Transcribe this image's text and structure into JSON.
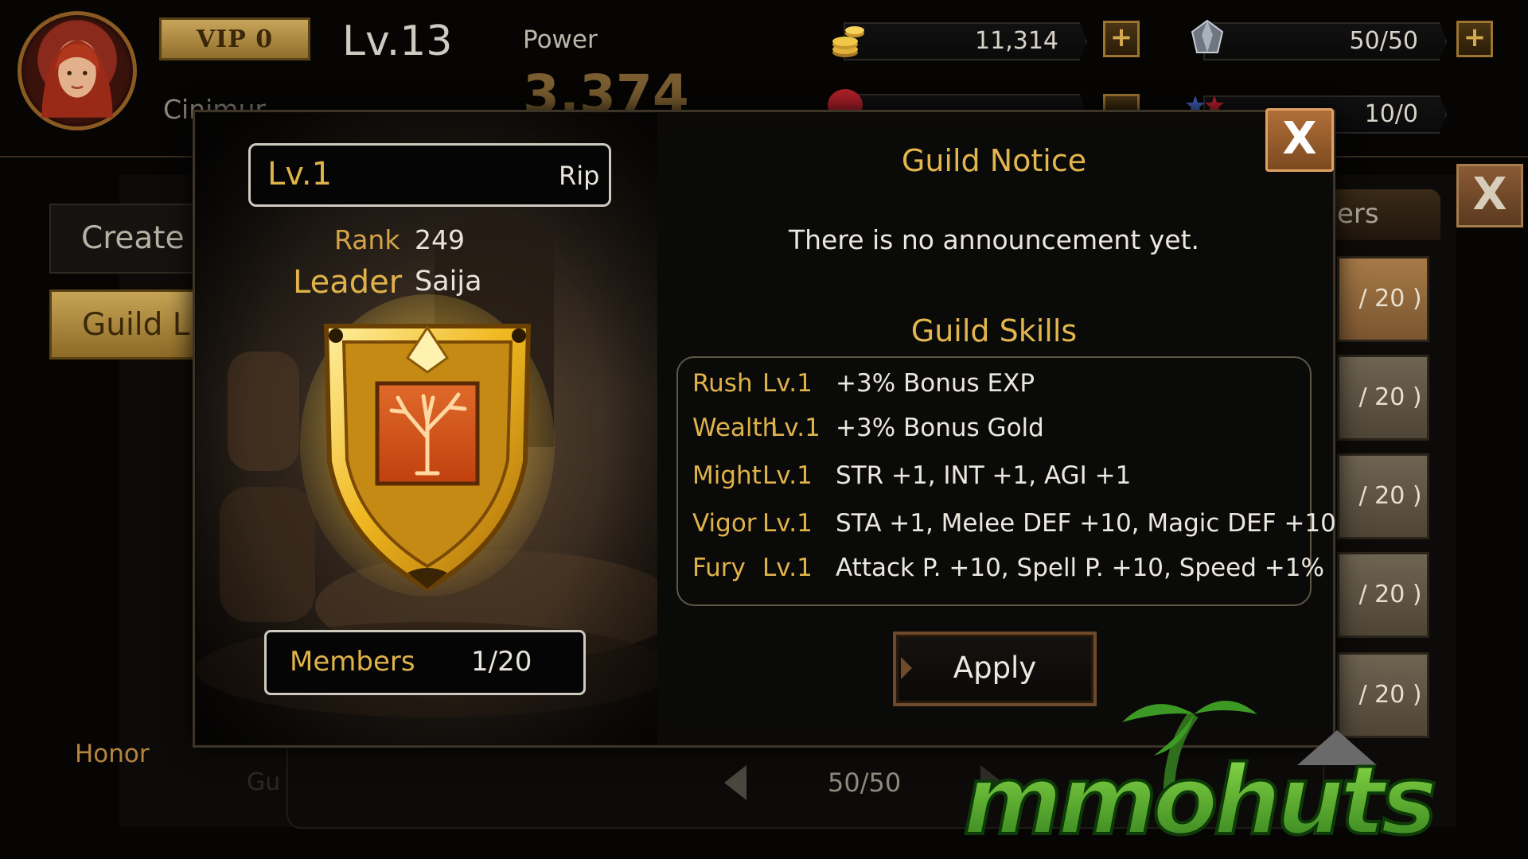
{
  "hud": {
    "vip": "VIP 0",
    "level": "Lv.13",
    "power_label": "Power",
    "power_value": "3,374",
    "player_name": "Cinimur",
    "gold": "11,314",
    "stamina": "50/50",
    "tickets": "10/0",
    "plus": "+"
  },
  "background": {
    "create_tab": "Create Guild",
    "list_tab": "Guild List",
    "honor": "Honor",
    "gu": "Gu",
    "pager": "50/50",
    "members_header": "ers",
    "slots": [
      "/ 20 )",
      "/ 20 )",
      "/ 20 )",
      "/ 20 )",
      "/ 20 )"
    ],
    "close": "X"
  },
  "dialog": {
    "level": "Lv.1",
    "guild_name": "Rip",
    "rank_label": "Rank",
    "rank_value": "249",
    "leader_label": "Leader",
    "leader_value": "Saija",
    "members_label": "Members",
    "members_value": "1/20",
    "notice_title": "Guild Notice",
    "notice_text": "There is no announcement yet.",
    "skills_title": "Guild Skills",
    "skills": [
      {
        "name": "Rush",
        "level": "Lv.1",
        "desc": "+3% Bonus EXP"
      },
      {
        "name": "Wealth",
        "level": "Lv.1",
        "desc": "+3% Bonus Gold"
      },
      {
        "name": "Might",
        "level": "Lv.1",
        "desc": "STR +1, INT +1, AGI +1"
      },
      {
        "name": "Vigor",
        "level": "Lv.1",
        "desc": "STA +1, Melee DEF +10, Magic DEF +10"
      },
      {
        "name": "Fury",
        "level": "Lv.1",
        "desc": "Attack P. +10, Spell P. +10, Speed +1%"
      }
    ],
    "apply": "Apply",
    "close": "X"
  },
  "icons": {
    "gold": "gold-coins-icon",
    "stamina": "crystal-icon",
    "ticket": "ticket-icon",
    "emblem": "tree-emblem-icon"
  },
  "watermark": "mmohuts"
}
